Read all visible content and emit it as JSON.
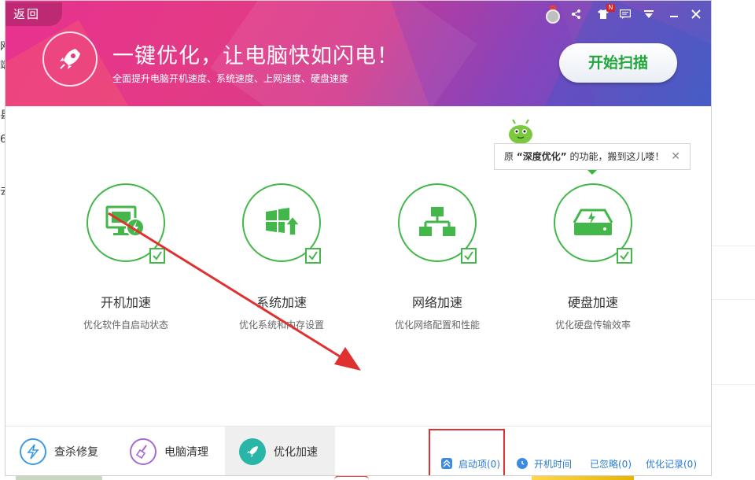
{
  "window": {
    "back_label": "返回",
    "title": "一键优化，让电脑快如闪电！",
    "subtitle": "全面提升电脑开机速度、系统速度、上网速度、硬盘速度",
    "scan_button": "开始扫描",
    "badge": "N"
  },
  "tooltip": {
    "prefix": "原",
    "highlight": "“深度优化”",
    "suffix": "的功能，搬到这儿喽！",
    "close": "✕"
  },
  "features": [
    {
      "name": "开机加速",
      "desc": "优化软件自启动状态"
    },
    {
      "name": "系统加速",
      "desc": "优化系统和内存设置"
    },
    {
      "name": "网络加速",
      "desc": "优化网络配置和性能"
    },
    {
      "name": "硬盘加速",
      "desc": "优化硬盘传输效率"
    }
  ],
  "nav": [
    {
      "label": "查杀修复"
    },
    {
      "label": "电脑清理"
    },
    {
      "label": "优化加速"
    }
  ],
  "bottom_links": {
    "startup": "启动项(0)",
    "boot_time": "开机时间",
    "ignored": "已忽略(0)",
    "history": "优化记录(0)"
  },
  "background_chars": [
    "网",
    "端",
    "县",
    "6",
    "去"
  ],
  "colors": {
    "accent_green": "#43b749",
    "link_blue": "#2a7bd3",
    "annotation_red": "#e03131"
  }
}
